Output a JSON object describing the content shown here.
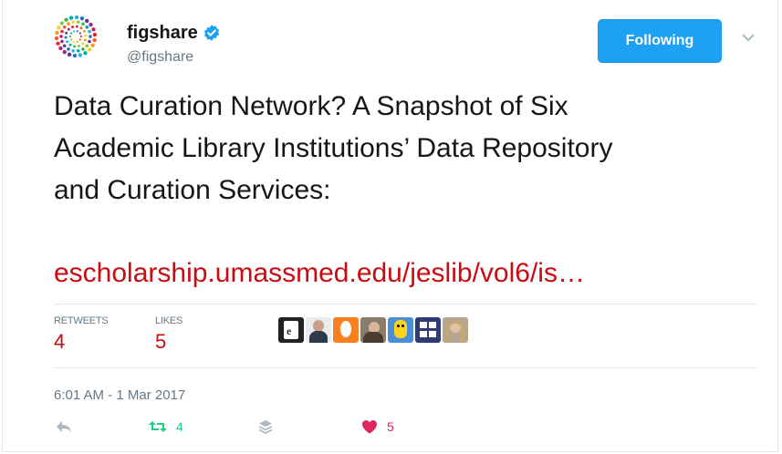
{
  "user": {
    "display_name": "figshare",
    "handle": "@figshare",
    "verified_icon": "verified-badge-icon"
  },
  "follow_button": {
    "label": "Following",
    "color": "#1da1f2"
  },
  "tweet": {
    "lines": [
      "Data Curation Network? A Snapshot of Six",
      "Academic Library Institutions’ Data Repository",
      "and Curation Services:"
    ],
    "link": "escholarship.umassmed.edu/jeslib/vol6/is…"
  },
  "stats": {
    "retweets_label": "RETWEETS",
    "retweets_value": "4",
    "likes_label": "LIKES",
    "likes_value": "5"
  },
  "timestamp": "6:01 AM - 1 Mar 2017",
  "actions": {
    "retweet_count": "4",
    "like_count": "5"
  },
  "colors": {
    "accent_red": "#ca0b11",
    "retweet_green": "#19cf86",
    "like_red": "#e0245e",
    "muted": "#657786"
  }
}
